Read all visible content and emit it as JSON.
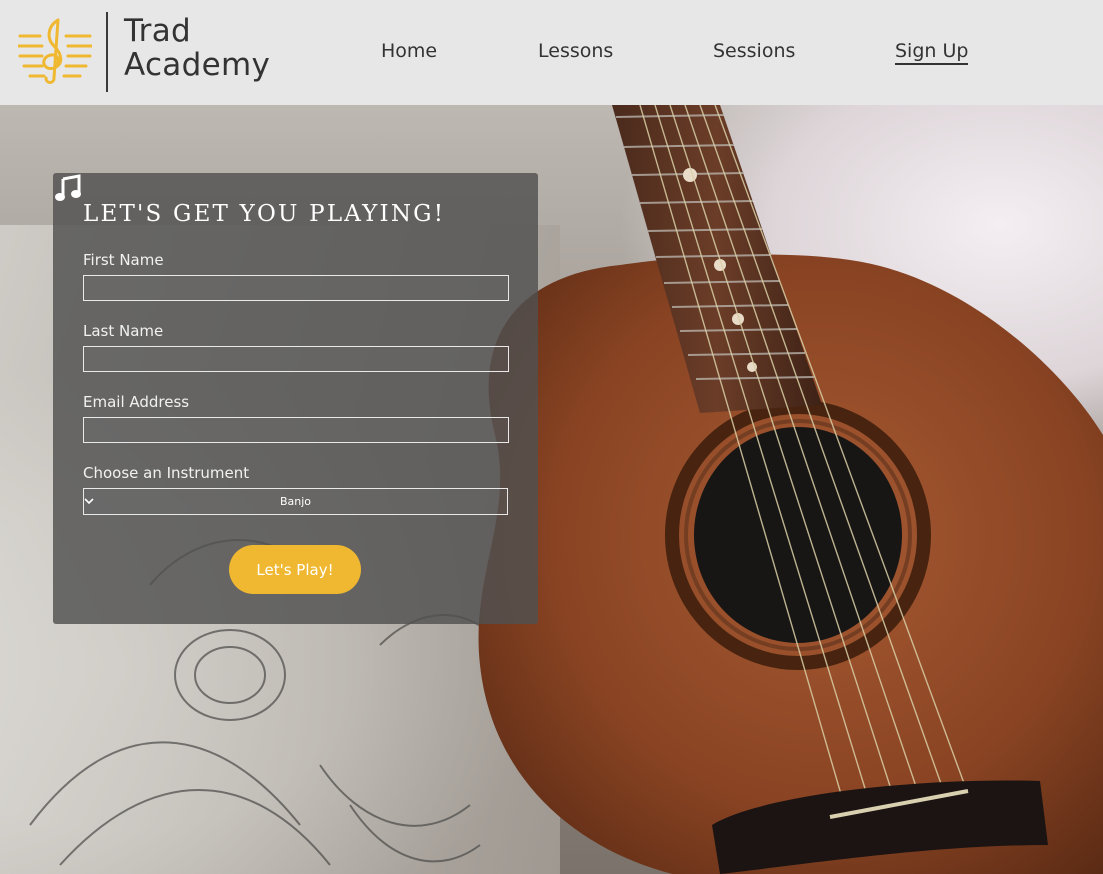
{
  "brand": {
    "line1": "Trad",
    "line2": "Academy",
    "logo_icon": "treble-clef-icon",
    "accent_color": "#efb830"
  },
  "nav": {
    "items": [
      {
        "label": "Home"
      },
      {
        "label": "Lessons"
      },
      {
        "label": "Sessions"
      },
      {
        "label": "Sign Up",
        "active": true
      }
    ]
  },
  "form": {
    "title": "Let's get you playing!",
    "title_icon": "music-note-icon",
    "fields": [
      {
        "label": "First Name",
        "value": ""
      },
      {
        "label": "Last Name",
        "value": ""
      },
      {
        "label": "Email Address",
        "value": ""
      }
    ],
    "instrument": {
      "label": "Choose an Instrument",
      "selected": "Banjo"
    },
    "submit_label": "Let's Play!"
  },
  "hero": {
    "image": "acoustic-guitar-photo"
  }
}
